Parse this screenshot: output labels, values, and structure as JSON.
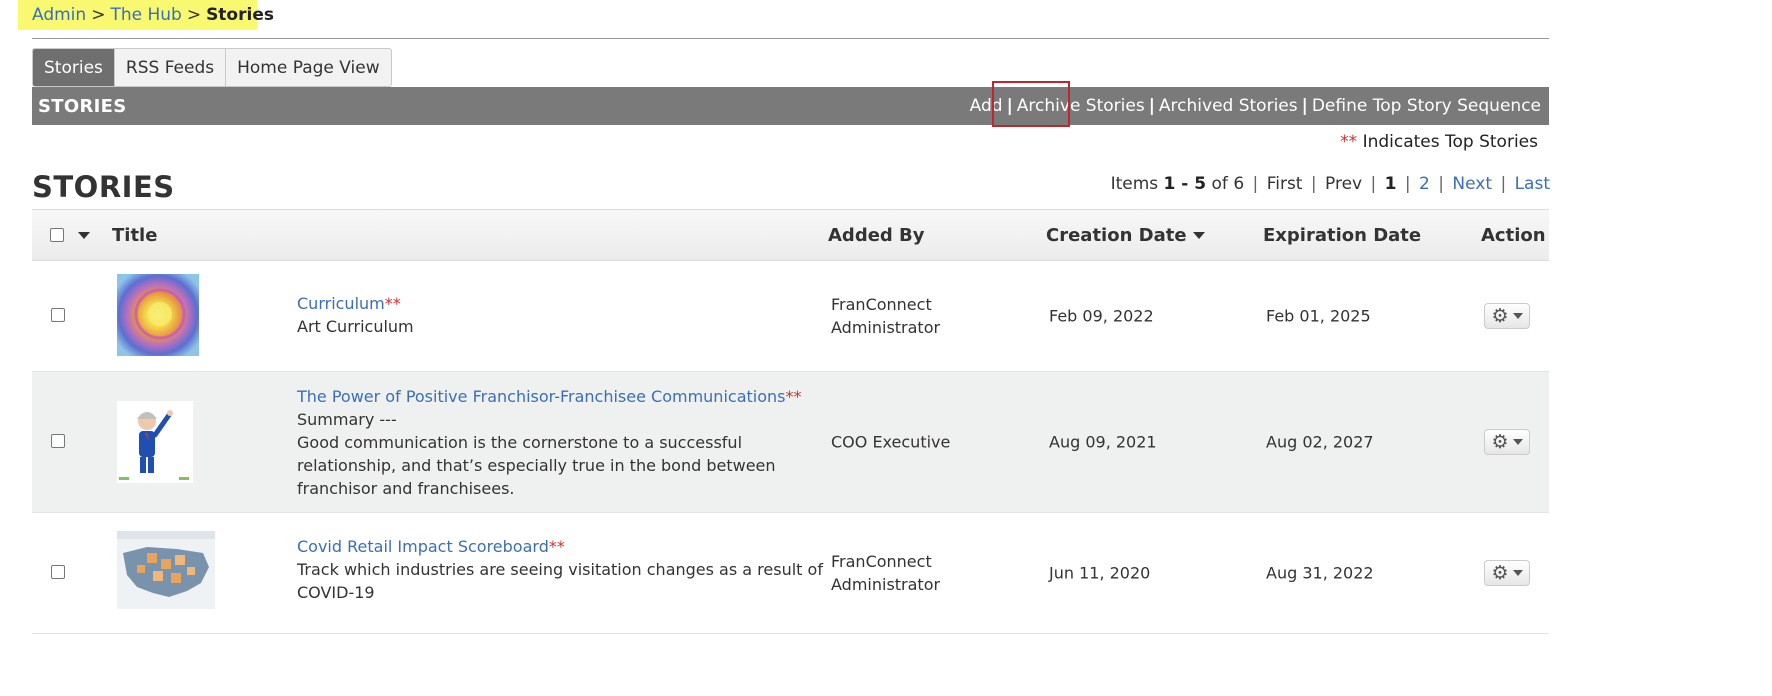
{
  "breadcrumb": {
    "admin": "Admin",
    "hub": "The Hub",
    "current": "Stories",
    "separator": ">"
  },
  "tabs": [
    {
      "label": "Stories",
      "active": true
    },
    {
      "label": "RSS Feeds",
      "active": false
    },
    {
      "label": "Home Page View",
      "active": false
    }
  ],
  "bar": {
    "title": "STORIES",
    "actions": {
      "add": "Add",
      "archive": "Archive Stories",
      "archived": "Archived Stories",
      "define": "Define Top Story Sequence"
    },
    "pipe": "|"
  },
  "legend": {
    "mark": "**",
    "text": "Indicates Top Stories"
  },
  "section_title": "STORIES",
  "pager": {
    "items_label": "Items",
    "range": "1 - 5",
    "of_label": "of",
    "total": "6",
    "first": "First",
    "prev": "Prev",
    "current": "1",
    "page2": "2",
    "next": "Next",
    "last": "Last",
    "sep": "|"
  },
  "table": {
    "headers": {
      "title": "Title",
      "added_by": "Added By",
      "creation_date": "Creation Date",
      "expiration_date": "Expiration Date",
      "action": "Action"
    },
    "rows": [
      {
        "title": "Curriculum",
        "mark": "**",
        "desc1": "Art Curriculum",
        "added_line1": "FranConnect",
        "added_line2": "Administrator",
        "created": "Feb 09, 2022",
        "expires": "Feb 01, 2025"
      },
      {
        "title": "The Power of Positive Franchisor-Franchisee Communications",
        "mark": "**",
        "desc1": "Summary ---",
        "desc2": "Good communication is the cornerstone to a successful",
        "desc3": "relationship, and that’s especially true in the bond between",
        "desc4": "franchisor and franchisees.",
        "added_line1": "COO Executive",
        "created": "Aug 09, 2021",
        "expires": "Aug 02, 2027"
      },
      {
        "title": "Covid Retail Impact Scoreboard",
        "mark": "**",
        "desc1": "Track which industries are seeing visitation changes as a result of",
        "desc2": "COVID-19",
        "added_line1": "FranConnect",
        "added_line2": "Administrator",
        "created": "Jun 11, 2020",
        "expires": "Aug 31, 2022"
      }
    ]
  },
  "icons": {
    "gear": "gear-icon",
    "caret": "chevron-down-icon"
  }
}
